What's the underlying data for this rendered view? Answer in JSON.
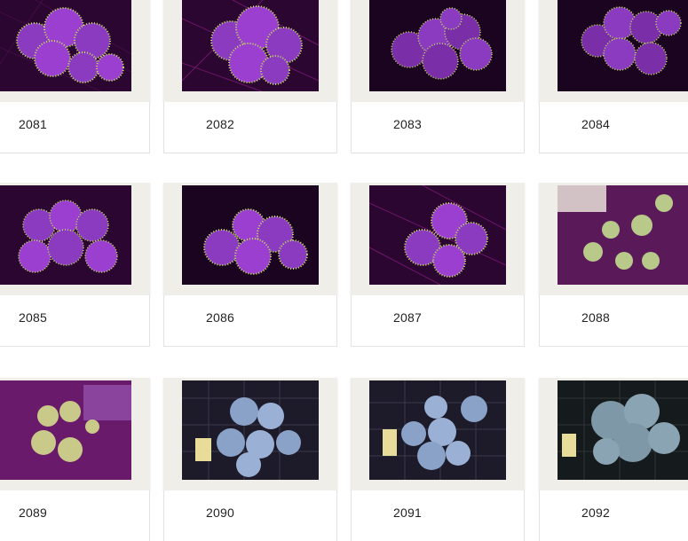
{
  "gallery": {
    "items": [
      {
        "label": "2081",
        "theme": "purple"
      },
      {
        "label": "2082",
        "theme": "purple"
      },
      {
        "label": "2083",
        "theme": "purple-dark"
      },
      {
        "label": "2084",
        "theme": "purple-dark"
      },
      {
        "label": "2085",
        "theme": "purple"
      },
      {
        "label": "2086",
        "theme": "purple-dark"
      },
      {
        "label": "2087",
        "theme": "purple"
      },
      {
        "label": "2088",
        "theme": "green-on-purple"
      },
      {
        "label": "2089",
        "theme": "green-on-purple"
      },
      {
        "label": "2090",
        "theme": "blue"
      },
      {
        "label": "2091",
        "theme": "blue"
      },
      {
        "label": "2092",
        "theme": "blue"
      }
    ]
  },
  "colors": {
    "frame": "#efeee9",
    "purple_bg": "#3a0a3c",
    "purple_polyp": "#9b3fd0",
    "polyp_tip": "#c8e85a",
    "green_polyp": "#b9c98a",
    "blue_bg": "#1d1a2a",
    "blue_polyp": "#8aa2c8"
  }
}
